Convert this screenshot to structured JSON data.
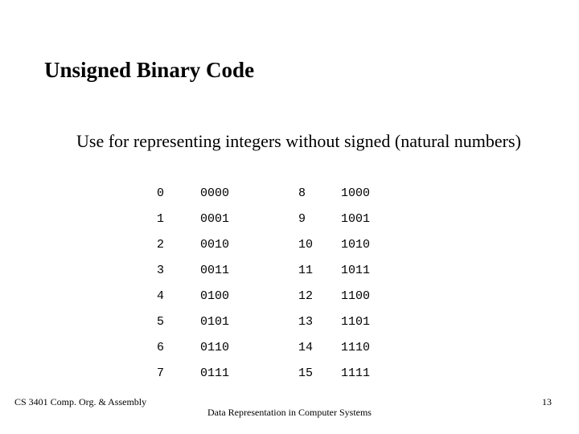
{
  "title": "Unsigned Binary Code",
  "subtitle": "Use for representing integers without signed (natural numbers)",
  "table": {
    "rows": [
      {
        "decA": "0",
        "binA": "0000",
        "decB": "8",
        "binB": "1000"
      },
      {
        "decA": "1",
        "binA": "0001",
        "decB": "9",
        "binB": "1001"
      },
      {
        "decA": "2",
        "binA": "0010",
        "decB": "10",
        "binB": "1010"
      },
      {
        "decA": "3",
        "binA": "0011",
        "decB": "11",
        "binB": "1011"
      },
      {
        "decA": "4",
        "binA": "0100",
        "decB": "12",
        "binB": "1100"
      },
      {
        "decA": "5",
        "binA": "0101",
        "decB": "13",
        "binB": "1101"
      },
      {
        "decA": "6",
        "binA": "0110",
        "decB": "14",
        "binB": "1110"
      },
      {
        "decA": "7",
        "binA": "0111",
        "decB": "15",
        "binB": "1111"
      }
    ]
  },
  "footer": {
    "left": "CS 3401 Comp. Org. & Assembly",
    "center": "Data Representation in Computer Systems",
    "right": "13"
  }
}
